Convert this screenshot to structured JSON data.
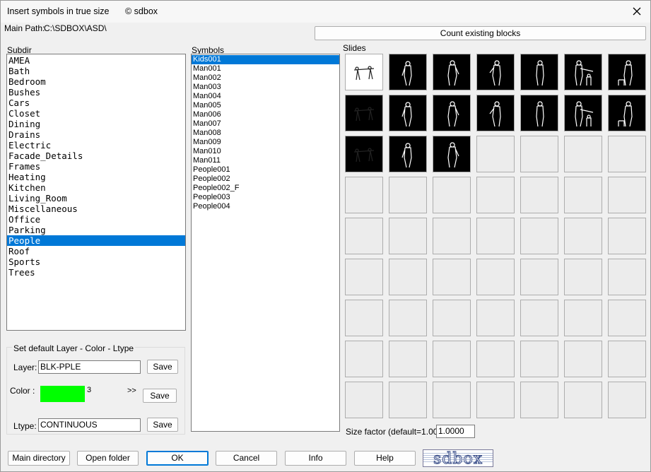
{
  "window": {
    "title": "Insert symbols in true size",
    "copyright": "© sdbox",
    "close_icon": "close-icon"
  },
  "main_path": {
    "label": "Main Path:",
    "value": "C:\\SDBOX\\ASD\\"
  },
  "count_button": "Count existing blocks",
  "subdir": {
    "label": "Subdir",
    "items": [
      "AMEA",
      "Bath",
      "Bedroom",
      "Bushes",
      "Cars",
      "Closet",
      "Dining",
      "Drains",
      "Electric",
      "Facade_Details",
      "Frames",
      "Heating",
      "Kitchen",
      "Living_Room",
      "Miscellaneous",
      "Office",
      "Parking",
      "People",
      "Roof",
      "Sports",
      "Trees"
    ],
    "selected": "People"
  },
  "symbols": {
    "label": "Symbols",
    "items": [
      "Kids001",
      "Man001",
      "Man002",
      "Man003",
      "Man004",
      "Man005",
      "Man006",
      "Man007",
      "Man008",
      "Man009",
      "Man010",
      "Man011",
      "People001",
      "People002",
      "People002_F",
      "People003",
      "People004"
    ],
    "selected": "Kids001"
  },
  "slides": {
    "label": "Slides",
    "filled_count": 17
  },
  "defaults": {
    "group_title": "Set default Layer - Color - Ltype",
    "layer_label": "Layer:",
    "layer_value": "BLK-PPLE",
    "color_label": "Color  :",
    "color_hex": "#00ff00",
    "color_number": "3",
    "color_more": ">>",
    "ltype_label": "Ltype:",
    "ltype_value": "CONTINUOUS",
    "save_label": "Save"
  },
  "size_factor": {
    "label": "Size factor (default=1.00):",
    "value": "1.0000"
  },
  "buttons": {
    "main_directory": "Main directory",
    "open_folder": "Open folder",
    "ok": "OK",
    "cancel": "Cancel",
    "info": "Info",
    "help": "Help"
  },
  "logo": {
    "text": "sdbox"
  }
}
